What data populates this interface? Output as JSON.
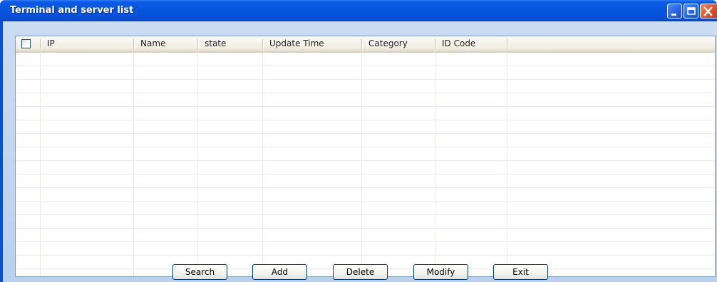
{
  "window": {
    "title": "Terminal and server list"
  },
  "title_buttons": [
    {
      "name": "minimize-button",
      "icon": "minimize-icon"
    },
    {
      "name": "maximize-button",
      "icon": "maximize-icon"
    },
    {
      "name": "close-button",
      "icon": "close-icon"
    }
  ],
  "table": {
    "select_all_checked": false,
    "columns": [
      {
        "key": "ip",
        "label": "IP"
      },
      {
        "key": "name",
        "label": "Name"
      },
      {
        "key": "state",
        "label": "state"
      },
      {
        "key": "update_time",
        "label": "Update Time"
      },
      {
        "key": "category",
        "label": "Category"
      },
      {
        "key": "id_code",
        "label": "ID Code"
      }
    ],
    "rows": []
  },
  "buttons": {
    "search": "Search",
    "add": "Add",
    "delete": "Delete",
    "modify": "Modify",
    "exit": "Exit"
  },
  "colors": {
    "titlebar": "#0855dd",
    "client_background": "#c9dcf2",
    "grid_border": "#7f9db9",
    "button_border": "#003c74"
  }
}
